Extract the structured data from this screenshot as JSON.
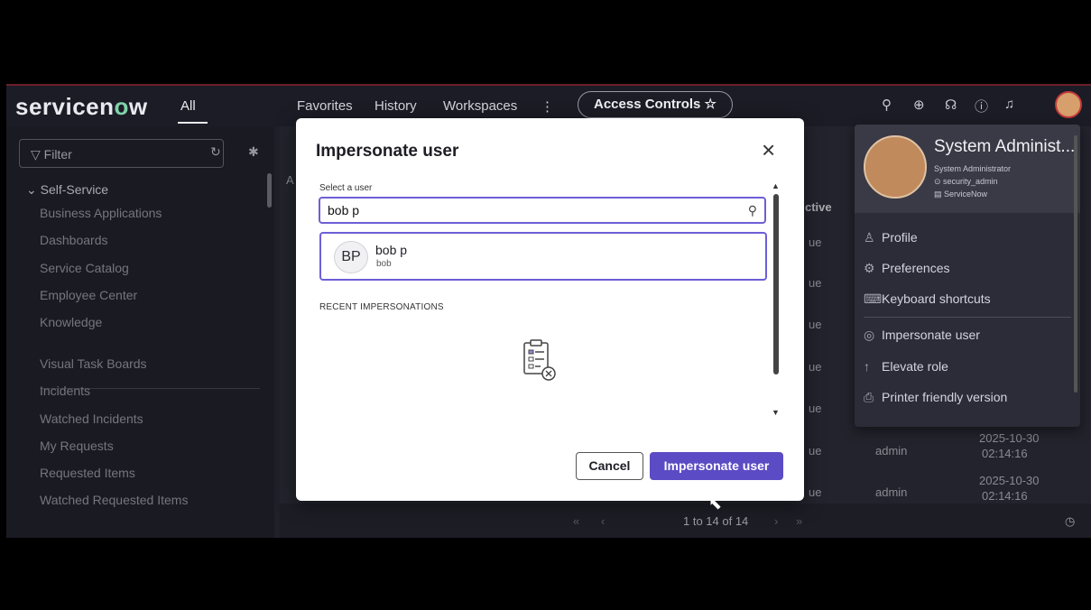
{
  "header": {
    "logo": "servicen",
    "logo_o": "o",
    "logo_w": "w",
    "all_label": "All",
    "nav": [
      "Favorites",
      "History",
      "Workspaces",
      "⋮"
    ],
    "pill_label": "Access Controls ☆"
  },
  "sidebar": {
    "filter_placeholder": "Filter",
    "section": "Self-Service",
    "items_a": [
      "Business Applications",
      "Dashboards",
      "Service Catalog",
      "Employee Center",
      "Knowledge"
    ],
    "items_b": [
      "Visual Task Boards",
      "Incidents",
      "Watched Incidents",
      "My Requests",
      "Requested Items",
      "Watched Requested Items"
    ]
  },
  "list": {
    "col_active": "ctive",
    "col_a": "A",
    "rows_partial": [
      "ue",
      "ue",
      "ue",
      "ue",
      "ue",
      "ue",
      "ue"
    ],
    "row_user": "admin",
    "row_date1": "2025-10-30",
    "row_time1": "02:14:16",
    "row_date2": "2025-10-30",
    "row_time2": "02:14:16",
    "pager": "1 to 14 of 14"
  },
  "modal": {
    "title": "Impersonate user",
    "select_label": "Select a user",
    "search_value": "bob p",
    "result_initials": "BP",
    "result_name": "bob p",
    "result_user": "bob",
    "recent_label": "RECENT IMPERSONATIONS",
    "cancel": "Cancel",
    "impersonate": "Impersonate user"
  },
  "user_menu": {
    "name": "System Administ...",
    "role": "System Administrator",
    "scope": "security_admin",
    "instance": "ServiceNow",
    "items": [
      "Profile",
      "Preferences",
      "Keyboard shortcuts",
      "Impersonate user",
      "Elevate role",
      "Printer friendly version"
    ]
  }
}
